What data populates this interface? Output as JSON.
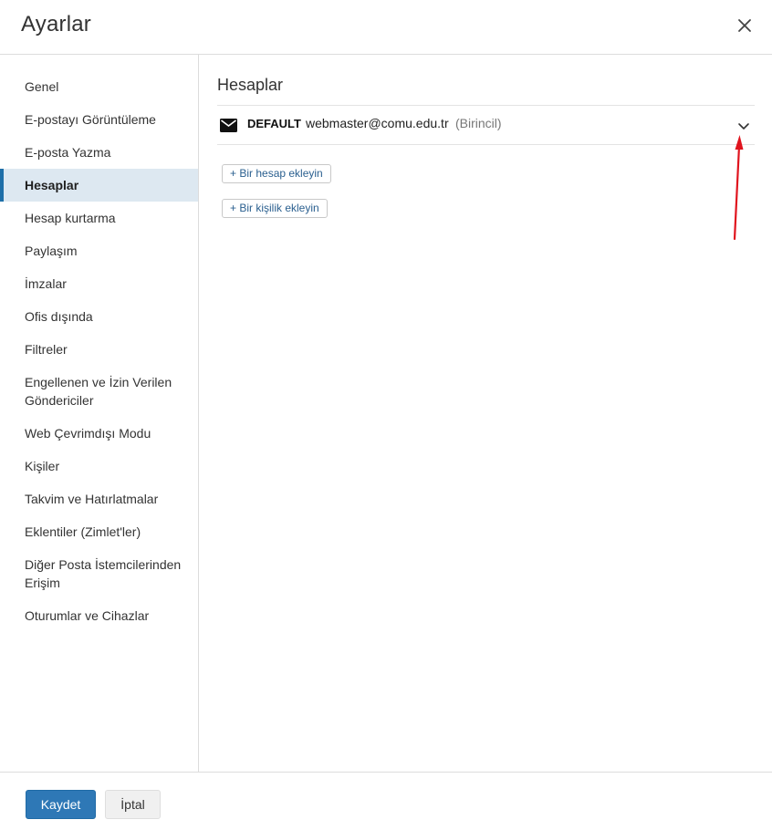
{
  "dialog": {
    "title": "Ayarlar",
    "close_icon": "close-icon"
  },
  "sidebar": {
    "items": [
      {
        "label": "Genel",
        "active": false
      },
      {
        "label": "E-postayı Görüntüleme",
        "active": false
      },
      {
        "label": "E-posta Yazma",
        "active": false
      },
      {
        "label": "Hesaplar",
        "active": true
      },
      {
        "label": "Hesap kurtarma",
        "active": false
      },
      {
        "label": "Paylaşım",
        "active": false
      },
      {
        "label": "İmzalar",
        "active": false
      },
      {
        "label": "Ofis dışında",
        "active": false
      },
      {
        "label": "Filtreler",
        "active": false
      },
      {
        "label": "Engellenen ve İzin Verilen Göndericiler",
        "active": false
      },
      {
        "label": "Web Çevrimdışı Modu",
        "active": false
      },
      {
        "label": "Kişiler",
        "active": false
      },
      {
        "label": "Takvim ve Hatırlatmalar",
        "active": false
      },
      {
        "label": "Eklentiler (Zimlet'ler)",
        "active": false
      },
      {
        "label": "Diğer Posta İstemcilerinden Erişim",
        "active": false
      },
      {
        "label": "Oturumlar ve Cihazlar",
        "active": false
      }
    ]
  },
  "main": {
    "section_title": "Hesaplar",
    "account": {
      "icon": "envelope-icon",
      "name": "DEFAULT",
      "email": "webmaster@comu.edu.tr",
      "status": "(Birincil)",
      "expand_icon": "chevron-down-icon"
    },
    "add_account_label": "+ Bir hesap ekleyin",
    "add_persona_label": "+ Bir kişilik ekleyin"
  },
  "footer": {
    "save_label": "Kaydet",
    "cancel_label": "İptal"
  },
  "colors": {
    "accent": "#2e78b6",
    "active_bg": "#dde8f1",
    "annotation": "#e0141e"
  }
}
